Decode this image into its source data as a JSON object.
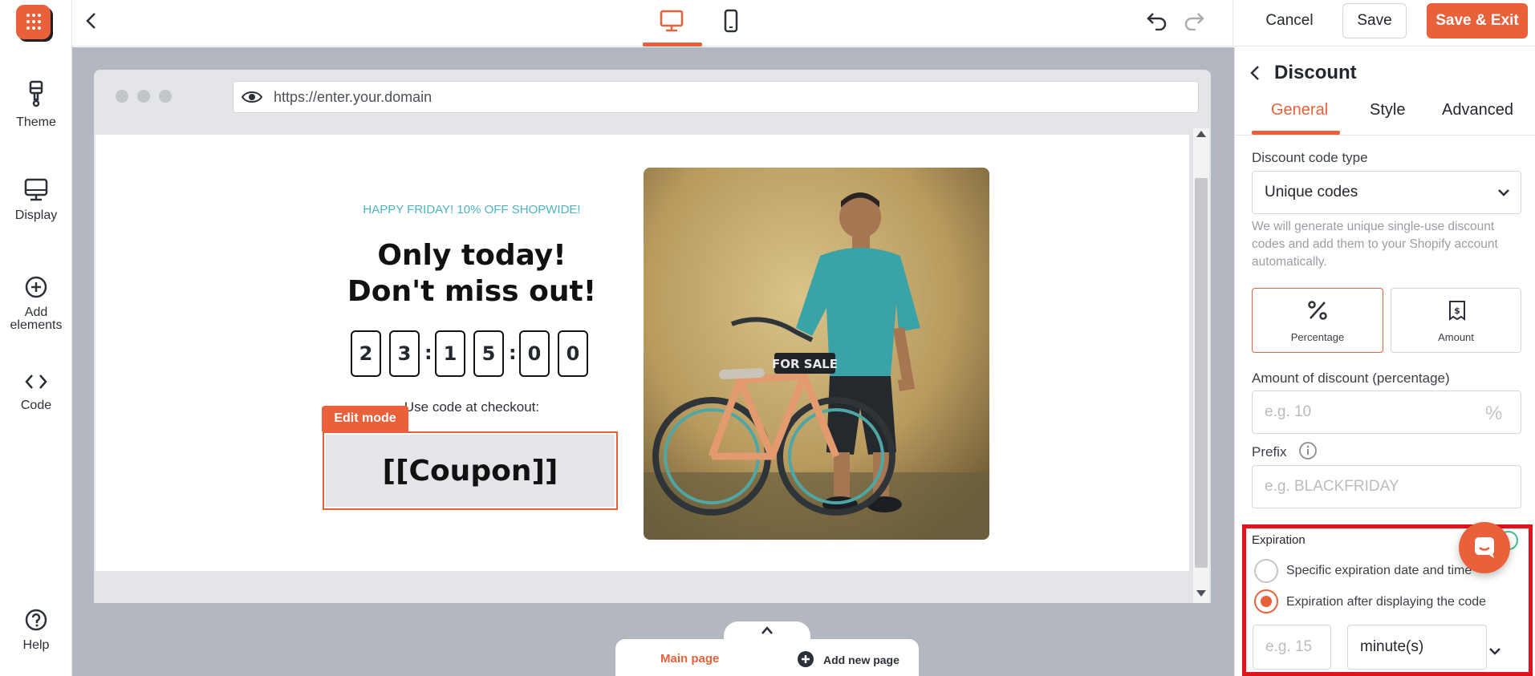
{
  "rail": {
    "items": [
      {
        "label": "Theme",
        "icon": "paintbrush-icon"
      },
      {
        "label": "Display",
        "icon": "monitor-icon"
      },
      {
        "label": "Add\nelements",
        "icon": "plus-circle-icon"
      },
      {
        "label": "Code",
        "icon": "code-icon"
      }
    ],
    "help_label": "Help"
  },
  "topbar": {
    "cancel_label": "Cancel",
    "save_label": "Save",
    "save_exit_label": "Save & Exit"
  },
  "browser": {
    "url": "https://enter.your.domain"
  },
  "popup": {
    "eyebrow": "HAPPY FRIDAY! 10% OFF SHOPWIDE!",
    "headline_1": "Only today!",
    "headline_2": "Don't miss out!",
    "countdown": [
      "2",
      "3",
      "1",
      "5",
      "0",
      "0"
    ],
    "use_code_text": "Use code at checkout:",
    "edit_mode_badge": "Edit mode",
    "coupon_text": "[[Coupon]]",
    "image_sign_text": "FOR SALE"
  },
  "pages_bar": {
    "main_page": "Main page",
    "add_new_page": "Add new page"
  },
  "panel": {
    "title": "Discount",
    "tabs": [
      "General",
      "Style",
      "Advanced"
    ],
    "code_type_label": "Discount code type",
    "code_type_value": "Unique codes",
    "code_type_help": "We will generate unique single-use discount codes and add them to your Shopify account automatically.",
    "type_options": [
      "Percentage",
      "Amount"
    ],
    "amount_label": "Amount of discount (percentage)",
    "amount_placeholder": "e.g. 10",
    "amount_suffix": "%",
    "prefix_label": "Prefix",
    "prefix_placeholder": "e.g. BLACKFRIDAY",
    "expiration_label": "Expiration",
    "expiration_options": [
      "Specific expiration date and time",
      "Expiration after displaying the code"
    ],
    "duration_placeholder": "e.g. 15",
    "duration_unit": "minute(s)"
  },
  "colors": {
    "accent": "#e9613a",
    "highlight_red": "#e0121b",
    "eyebrow_teal": "#4fb3bf"
  }
}
